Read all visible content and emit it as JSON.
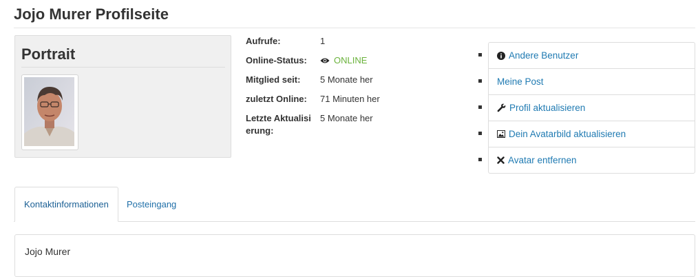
{
  "page": {
    "title": "Jojo Murer Profilseite"
  },
  "portrait": {
    "title": "Portrait",
    "avatar_alt": "Jojo Murer"
  },
  "details": [
    {
      "label": "Aufrufe:",
      "value": "1"
    },
    {
      "label": "Online-Status:",
      "value": "ONLINE",
      "icon": "eye-icon"
    },
    {
      "label": "Mitglied seit:",
      "value": "5 Monate her"
    },
    {
      "label": "zuletzt Online:",
      "value": "71 Minuten her"
    },
    {
      "label": "Letzte Aktualisierung:",
      "value": "5 Monate her"
    }
  ],
  "actions": [
    {
      "label": "Andere Benutzer",
      "icon": "info-circle-icon"
    },
    {
      "label": "Meine Post",
      "icon": ""
    },
    {
      "label": "Profil aktualisieren",
      "icon": "wrench-icon"
    },
    {
      "label": "Dein Avatarbild aktualisieren",
      "icon": "image-icon"
    },
    {
      "label": "Avatar entfernen",
      "icon": "close-icon"
    }
  ],
  "tabs": [
    {
      "label": "Kontaktinformationen",
      "active": true
    },
    {
      "label": "Posteingang",
      "active": false
    }
  ],
  "contact": {
    "name": "Jojo Murer"
  },
  "colors": {
    "link": "#1f7ab2",
    "online": "#6ab23b",
    "border": "#dddddd",
    "portrait_bg": "#f0f0f0"
  }
}
